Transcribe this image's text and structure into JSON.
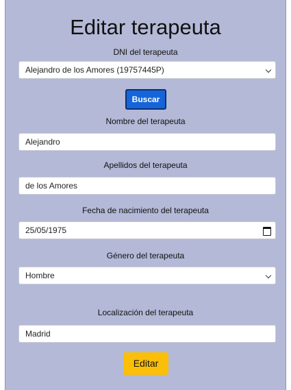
{
  "page": {
    "title": "Editar terapeuta"
  },
  "dni": {
    "label": "DNI del terapeuta",
    "selected": "Alejandro de los Amores (19757445P)",
    "chevron_icon": "chevron-down-icon"
  },
  "buscar": {
    "label": "Buscar",
    "color": "#1565d8"
  },
  "nombre": {
    "label": "Nombre del terapeuta",
    "value": "Alejandro"
  },
  "apellidos": {
    "label": "Apellidos del terapeuta",
    "value": "de los Amores"
  },
  "fecha": {
    "label": "Fecha de nacimiento del terapeuta",
    "value": "25/05/1975",
    "icon": "calendar-icon"
  },
  "genero": {
    "label": "Género del terapeuta",
    "selected": "Hombre",
    "chevron_icon": "chevron-down-icon"
  },
  "localizacion": {
    "label": "Localización del terapeuta",
    "value": "Madrid"
  },
  "editar": {
    "label": "Editar",
    "color": "#fbbf0a"
  },
  "colors": {
    "panel_background": "#b3b9d6"
  }
}
